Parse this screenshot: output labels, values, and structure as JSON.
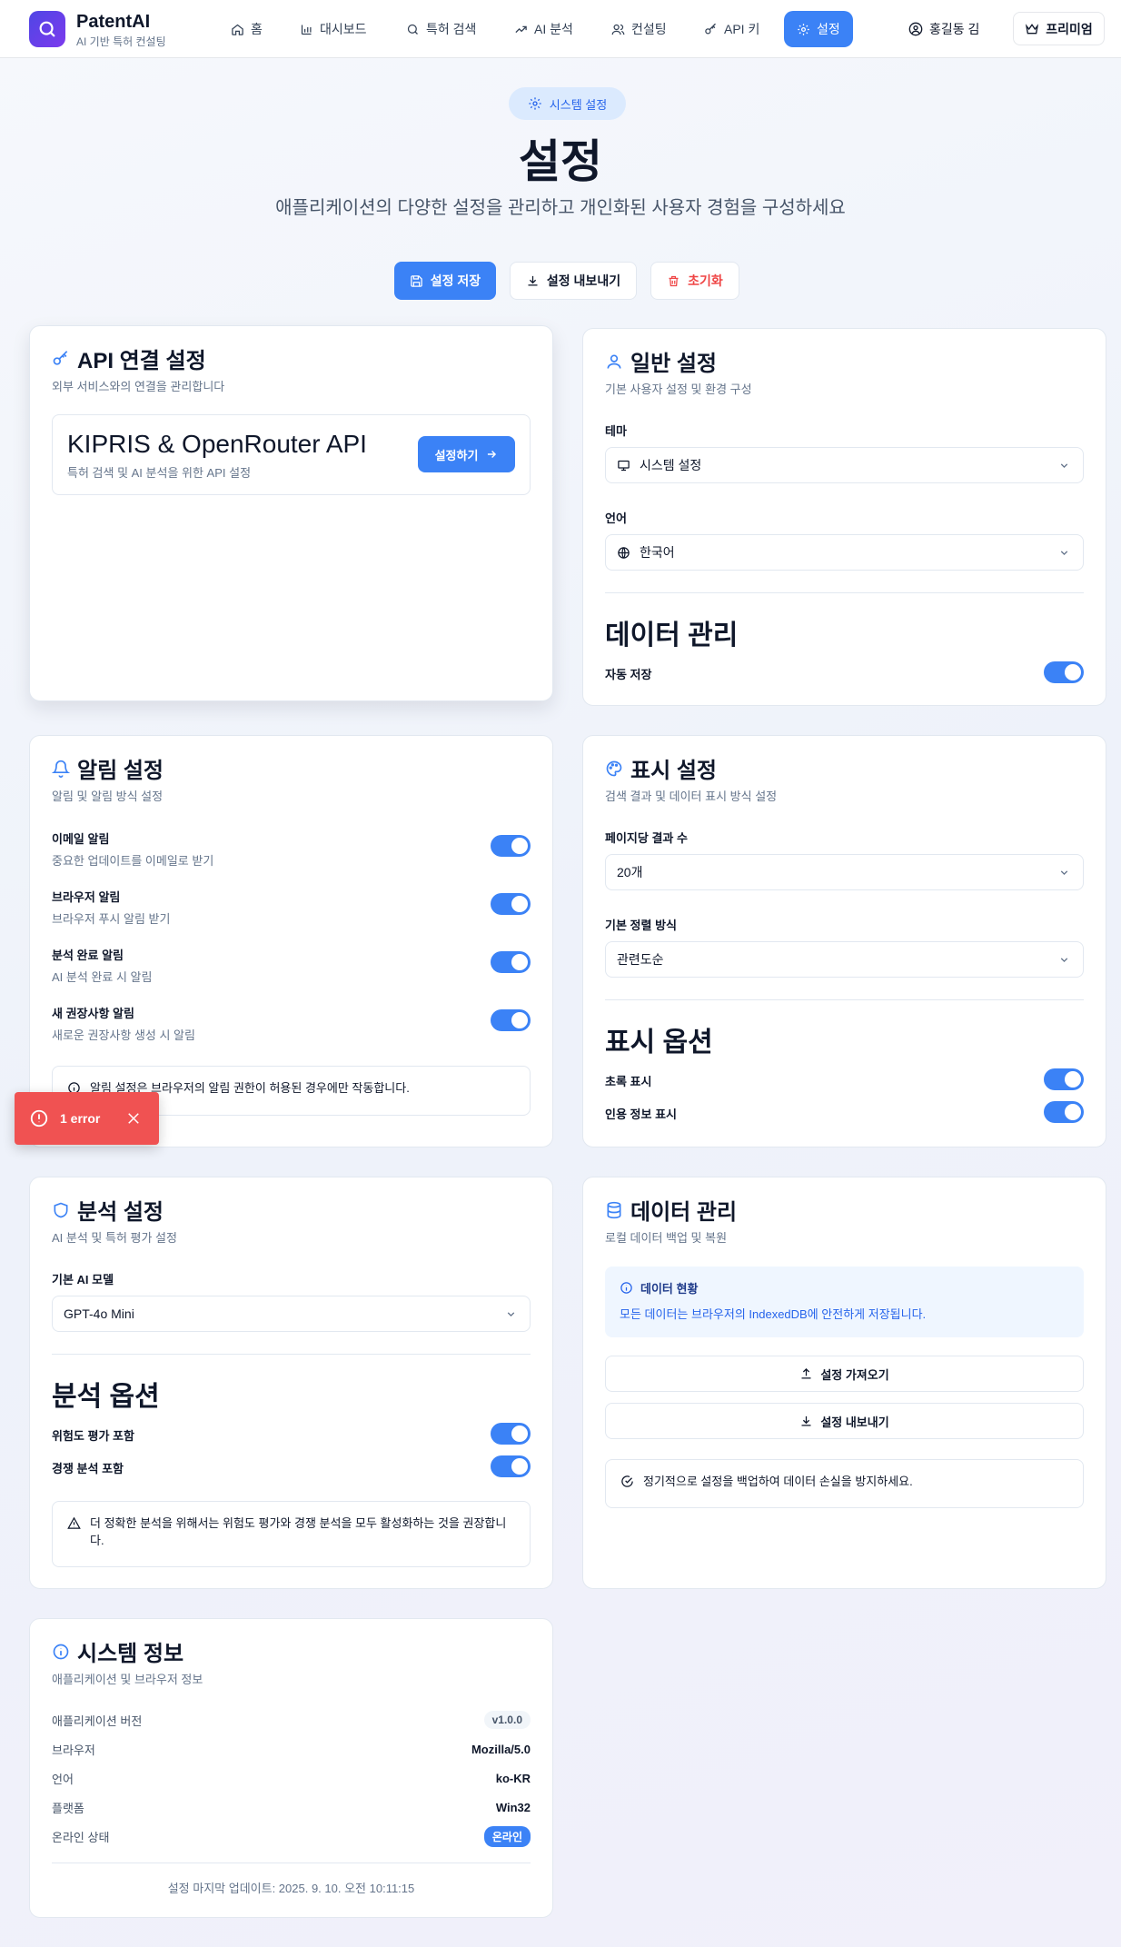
{
  "nav": {
    "brand": "PatentAI",
    "brand_sub": "AI 기반 특허 컨설팅",
    "items": [
      {
        "label": "홈",
        "icon": "home-icon"
      },
      {
        "label": "대시보드",
        "icon": "bar-chart-icon"
      },
      {
        "label": "특허 검색",
        "icon": "search-icon"
      },
      {
        "label": "AI 분석",
        "icon": "trending-icon"
      },
      {
        "label": "컨설팅",
        "icon": "users-icon"
      },
      {
        "label": "API 키",
        "icon": "key-icon"
      },
      {
        "label": "설정",
        "icon": "gear-icon",
        "active": true
      }
    ],
    "user": "홍길동 김",
    "premium": "프리미엄"
  },
  "header": {
    "badge": "시스템 설정",
    "title": "설정",
    "subtitle": "애플리케이션의 다양한 설정을 관리하고 개인화된 사용자 경험을 구성하세요"
  },
  "actions": {
    "save": "설정 저장",
    "export": "설정 내보내기",
    "reset": "초기화"
  },
  "api": {
    "title": "API 연결 설정",
    "desc": "외부 서비스와의 연결을 관리합니다",
    "box_title": "KIPRIS & OpenRouter API",
    "box_desc": "특허 검색 및 AI 분석을 위한 API 설정",
    "button": "설정하기"
  },
  "general": {
    "title": "일반 설정",
    "desc": "기본 사용자 설정 및 환경 구성",
    "theme_label": "테마",
    "theme_value": "시스템 설정",
    "language_label": "언어",
    "language_value": "한국어",
    "data_heading": "데이터 관리",
    "autosave_label": "자동 저장",
    "autosave_on": true
  },
  "notifications": {
    "title": "알림 설정",
    "desc": "알림 및 알림 방식 설정",
    "items": [
      {
        "label": "이메일 알림",
        "sub": "중요한 업데이트를 이메일로 받기",
        "on": true
      },
      {
        "label": "브라우저 알림",
        "sub": "브라우저 푸시 알림 받기",
        "on": true
      },
      {
        "label": "분석 완료 알림",
        "sub": "AI 분석 완료 시 알림",
        "on": true
      },
      {
        "label": "새 권장사항 알림",
        "sub": "새로운 권장사항 생성 시 알림",
        "on": true
      }
    ],
    "note": "알림 설정은 브라우저의 알림 권한이 허용된 경우에만 작동합니다."
  },
  "display": {
    "title": "표시 설정",
    "desc": "검색 결과 및 데이터 표시 방식 설정",
    "page_size_label": "페이지당 결과 수",
    "page_size_value": "20개",
    "sort_label": "기본 정렬 방식",
    "sort_value": "관련도순",
    "options_heading": "표시 옵션",
    "abstract_label": "초록 표시",
    "citation_label": "인용 정보 표시"
  },
  "analysis": {
    "title": "분석 설정",
    "desc": "AI 분석 및 특허 평가 설정",
    "model_label": "기본 AI 모델",
    "model_value": "GPT-4o Mini",
    "options_heading": "분석 옵션",
    "risk_label": "위험도 평가 포함",
    "competition_label": "경쟁 분석 포함",
    "note": "더 정확한 분석을 위해서는 위험도 평가와 경쟁 분석을 모두 활성화하는 것을 권장합니다."
  },
  "data_mgmt": {
    "title": "데이터 관리",
    "desc": "로컬 데이터 백업 및 복원",
    "status_title": "데이터 현황",
    "status_text": "모든 데이터는 브라우저의 IndexedDB에 안전하게 저장됩니다.",
    "import": "설정 가져오기",
    "export": "설정 내보내기",
    "tip": "정기적으로 설정을 백업하여 데이터 손실을 방지하세요."
  },
  "system": {
    "title": "시스템 정보",
    "desc": "애플리케이션 및 브라우저 정보",
    "rows": [
      {
        "k": "애플리케이션 버전",
        "v": "v1.0.0"
      },
      {
        "k": "브라우저",
        "v": "Mozilla/5.0"
      },
      {
        "k": "언어",
        "v": "ko-KR"
      },
      {
        "k": "플랫폼",
        "v": "Win32"
      },
      {
        "k": "온라인 상태",
        "v": "온라인"
      }
    ],
    "footer": "설정 마지막 업데이트: 2025. 9. 10. 오전 10:11:15"
  },
  "toast": {
    "text": "1 error"
  },
  "colors": {
    "accent": "#3b82f6",
    "danger": "#ef4444",
    "toast": "#f05252"
  }
}
